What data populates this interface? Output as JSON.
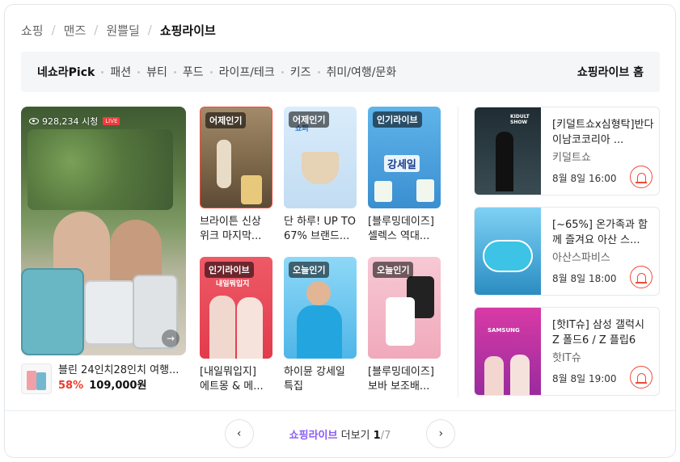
{
  "breadcrumb": [
    "쇼핑",
    "맨즈",
    "원쁠딜",
    "쇼핑라이브"
  ],
  "categories": [
    {
      "label": "네쇼라Pick",
      "active": true
    },
    {
      "label": "패션"
    },
    {
      "label": "뷰티"
    },
    {
      "label": "푸드"
    },
    {
      "label": "라이프/테크"
    },
    {
      "label": "키즈"
    },
    {
      "label": "취미/여행/문화"
    }
  ],
  "home_link": "쇼핑라이브 홈",
  "featured": {
    "viewers": "928,234 시청",
    "product_name": "블린 24인치28인치 여행...",
    "discount": "58%",
    "price": "109,000원"
  },
  "grid": [
    {
      "badge": "어제인기",
      "title": "브라이튼 신상 위크 마지막...",
      "bordered": true,
      "bg": "#8a6f55"
    },
    {
      "badge": "어제인기",
      "title": "단 하루! UP TO 67% 브랜드...",
      "bordered": false,
      "bg": "#cfe4f5",
      "art_text": "쇼퍼"
    },
    {
      "badge": "인기라이브",
      "title": "[블루밍데이즈] 셀렉스 역대...",
      "bordered": false,
      "bg": "#4aa3e0",
      "art_text": "강세일"
    },
    {
      "badge": "인기라이브",
      "title": "[내일뭐입지] 에트몽 & 메...",
      "bordered": false,
      "bg": "#ea4b5a",
      "art_text": "내일뭐입지"
    },
    {
      "badge": "오늘인기",
      "title": "하이뮨 강세일 특집",
      "bordered": false,
      "bg": "#5fc4ef"
    },
    {
      "badge": "오늘인기",
      "title": "[블루밍데이즈] 보바 보조배...",
      "bordered": false,
      "bg": "#f4b7c6"
    }
  ],
  "right_list": [
    {
      "title": "[키덜트쇼x심형탁]반다이남코코리아 ...",
      "seller": "키덜트쇼",
      "date": "8월 8일 16:00",
      "bg": "#2b3a40",
      "art_text": "KIDULT SHOW"
    },
    {
      "title": "[~65%] 온가족과 함께 즐겨요 아산 스...",
      "seller": "아산스파비스",
      "date": "8월 8일 18:00",
      "bg": "#6cc0e8"
    },
    {
      "title": "[핫IT슈] 삼성 갤럭시 Z 폴드6 / Z 플립6",
      "seller": "핫IT슈",
      "date": "8월 8일 19:00",
      "bg": "#c0309a",
      "art_text": "SAMSUNG"
    }
  ],
  "pager": {
    "brand": "쇼핑라이브",
    "more": "더보기",
    "current": "1",
    "total": "/7",
    "prev_icon": "chevron-left-icon",
    "next_icon": "chevron-right-icon"
  },
  "colors": {
    "accent_red": "#f04b3a",
    "brand_purple": "#8a5cf6"
  }
}
